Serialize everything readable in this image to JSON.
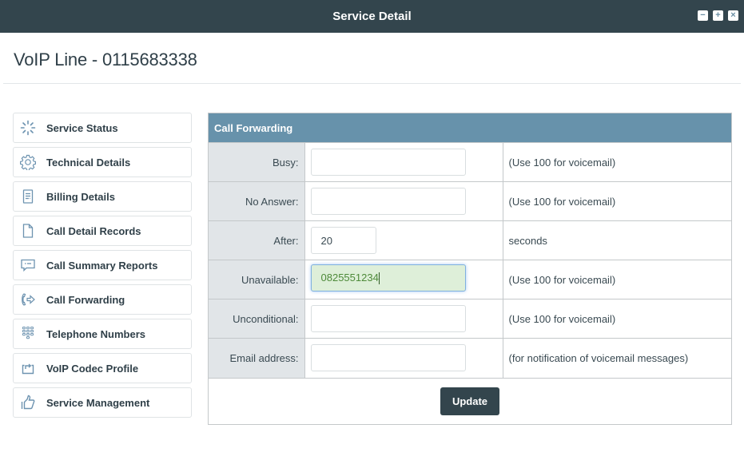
{
  "window": {
    "title": "Service Detail",
    "controls": [
      {
        "name": "minimize",
        "glyph": "−"
      },
      {
        "name": "maximize",
        "glyph": "+"
      },
      {
        "name": "close",
        "glyph": "×"
      }
    ]
  },
  "page": {
    "title": "VoIP Line - 0115683338"
  },
  "sidebar": {
    "items": [
      {
        "label": "Service Status",
        "icon": "spinner-icon"
      },
      {
        "label": "Technical Details",
        "icon": "gear-icon"
      },
      {
        "label": "Billing Details",
        "icon": "document-list-icon"
      },
      {
        "label": "Call Detail Records",
        "icon": "file-icon"
      },
      {
        "label": "Call Summary Reports",
        "icon": "chat-bubble-icon"
      },
      {
        "label": "Call Forwarding",
        "icon": "phone-forward-icon"
      },
      {
        "label": "Telephone Numbers",
        "icon": "keypad-icon"
      },
      {
        "label": "VoIP Codec Profile",
        "icon": "share-box-icon"
      },
      {
        "label": "Service Management",
        "icon": "thumbs-up-icon"
      }
    ]
  },
  "call_forwarding": {
    "header": "Call Forwarding",
    "rows": [
      {
        "label": "Busy:",
        "value": "",
        "hint": "(Use 100 for voicemail)"
      },
      {
        "label": "No Answer:",
        "value": "",
        "hint": "(Use 100 for voicemail)"
      },
      {
        "label": "After:",
        "value": "20",
        "hint": "seconds"
      },
      {
        "label": "Unavailable:",
        "value": "0825551234",
        "hint": "(Use 100 for voicemail)"
      },
      {
        "label": "Unconditional:",
        "value": "",
        "hint": "(Use 100 for voicemail)"
      },
      {
        "label": "Email address:",
        "value": "",
        "hint": "(for notification of voicemail messages)"
      }
    ],
    "update_label": "Update"
  },
  "colors": {
    "titlebar": "#33454d",
    "panel_header": "#6792ab",
    "label_cell_bg": "#e1e5e8",
    "focused_input_bg": "#deefd9",
    "button_bg": "#33454d"
  }
}
